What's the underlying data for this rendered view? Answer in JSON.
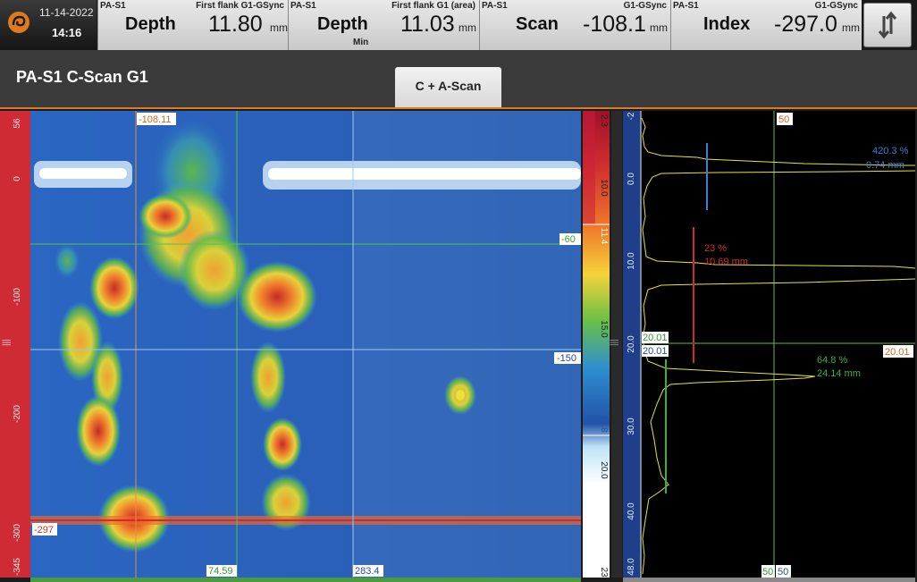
{
  "status": {
    "date": "11-14-2022",
    "time": "14:16"
  },
  "readings": [
    {
      "group": "PA-S1",
      "source": "First flank G1-GSync",
      "name": "Depth",
      "value": "11.80",
      "unit": "mm",
      "sub": ""
    },
    {
      "group": "PA-S1",
      "source": "First flank G1 (area)",
      "name": "Depth",
      "value": "11.03",
      "unit": "mm",
      "sub": "Min"
    },
    {
      "group": "PA-S1",
      "source": "G1-GSync",
      "name": "Scan",
      "value": "-108.1",
      "unit": "mm",
      "sub": ""
    },
    {
      "group": "PA-S1",
      "source": "G1-GSync",
      "name": "Index",
      "value": "-297.0",
      "unit": "mm",
      "sub": ""
    }
  ],
  "panel": {
    "title": "PA-S1 C-Scan G1",
    "tab_label": "C + A-Scan"
  },
  "cscan": {
    "left_ruler_ticks": [
      "56",
      "0",
      "-100",
      "-200",
      "-300",
      "-345"
    ],
    "cursor_labels": {
      "scan": "-108.11",
      "index": "-297",
      "ref_h1": "-60",
      "ref_h2": "-150",
      "ref_v1": "74.59",
      "ref_v2": "283.4"
    },
    "palette_ticks": [
      "2.3",
      "10.0",
      "11.4",
      "15.0",
      "18.8",
      "20.0",
      "23"
    ]
  },
  "ascan": {
    "depth_ticks": [
      "-2",
      "0.0",
      "10.0",
      "20.0",
      "30.0",
      "40.0",
      "48.0"
    ],
    "gate_labels": {
      "top_gate": "50",
      "bottom_gate_a": "50",
      "bottom_gate_b": "50",
      "left_a": "20.01",
      "left_b": "20.01",
      "right": "20.01"
    },
    "markers": [
      {
        "amp": "420.3 %",
        "depth": "0.74 mm",
        "color": "#3a7fd5"
      },
      {
        "amp": "23 %",
        "depth": "10.69 mm",
        "color": "#d03030"
      },
      {
        "amp": "64.8 %",
        "depth": "24.14 mm",
        "color": "#3fb040"
      }
    ]
  },
  "colors": {
    "accent": "#e07a1e",
    "cursor_red": "#d42a2a",
    "ref_green": "#5bbf4a"
  }
}
